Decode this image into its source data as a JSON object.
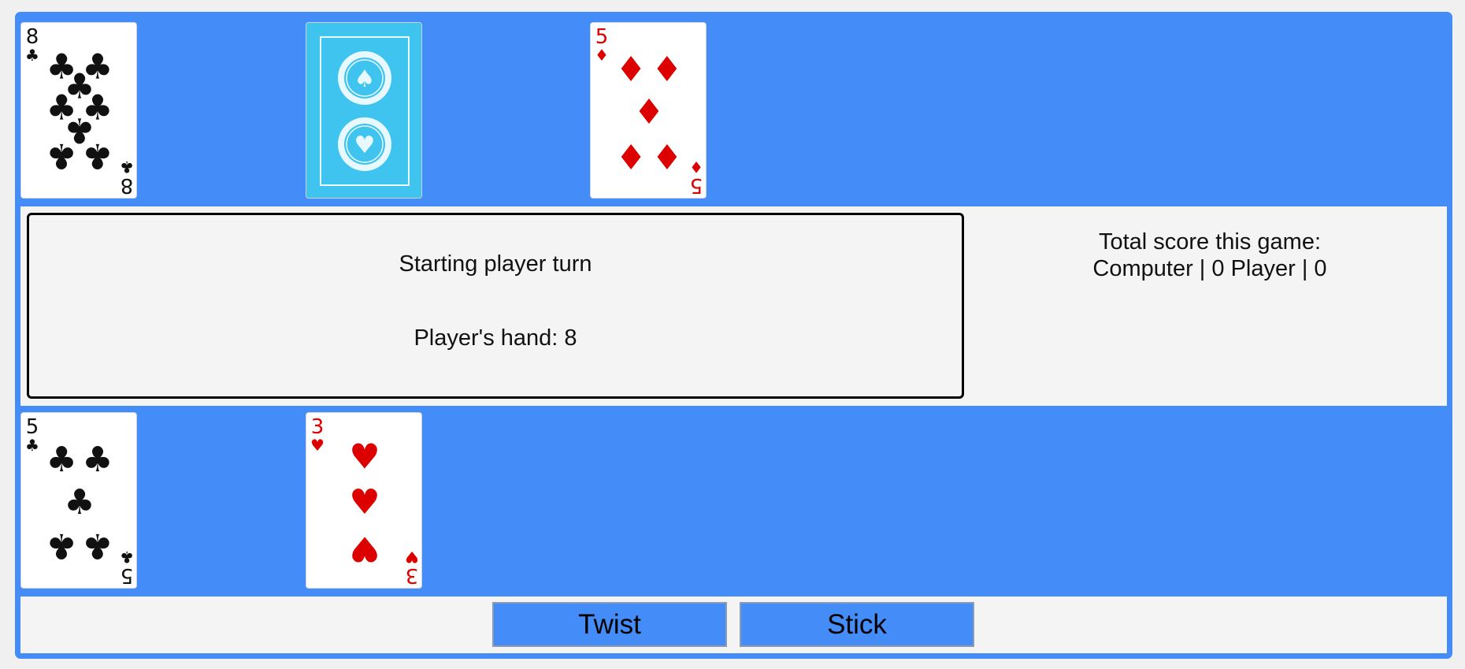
{
  "colors": {
    "table": "#448cf7",
    "panel": "#f4f4f4",
    "card_back": "#3fc4ef",
    "black_suit": "#111111",
    "red_suit": "#dd0000"
  },
  "computer_hand": [
    {
      "rank": "8",
      "suit": "clubs",
      "face_up": true,
      "icon": "clubs-icon"
    },
    {
      "face_up": false,
      "icon": "card-back-icon"
    },
    {
      "rank": "5",
      "suit": "diamonds",
      "face_up": true,
      "icon": "diamonds-icon"
    }
  ],
  "player_hand": [
    {
      "rank": "5",
      "suit": "clubs",
      "face_up": true,
      "icon": "clubs-icon"
    },
    {
      "rank": "3",
      "suit": "hearts",
      "face_up": true,
      "icon": "hearts-icon"
    }
  ],
  "status": {
    "turn_message": "Starting player turn",
    "hand_message": "Player's hand: 8"
  },
  "score": {
    "line1": "Total score this game:",
    "line2": "Computer | 0 Player | 0"
  },
  "controls": {
    "twist_label": "Twist",
    "stick_label": "Stick"
  }
}
